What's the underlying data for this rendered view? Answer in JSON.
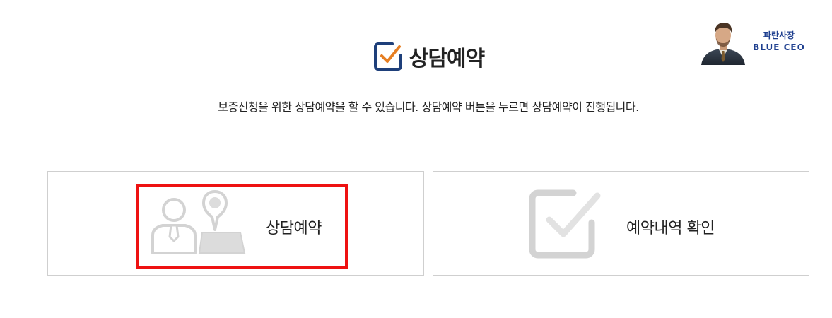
{
  "header": {
    "title": "상담예약",
    "title_icon": "check-square-icon",
    "icon_colors": {
      "frame": "#1e3f7a",
      "check": "#e67e22"
    }
  },
  "logo": {
    "name_ko": "파란사장",
    "name_en": "BLUE CEO",
    "color": "#1e3f8f"
  },
  "description": "보증신청을 위한 상담예약을 할 수 있습니다. 상담예약 버튼을 누르면 상담예약이 진행됩니다.",
  "cards": {
    "consult": {
      "label": "상담예약",
      "icon": "consultant-location-icon",
      "selected": true
    },
    "history": {
      "label": "예약내역 확인",
      "icon": "checkbox-icon"
    }
  },
  "colors": {
    "highlight": "#ee1111",
    "icon_gray": "#d3d3d3",
    "border": "#cfcfcf"
  }
}
